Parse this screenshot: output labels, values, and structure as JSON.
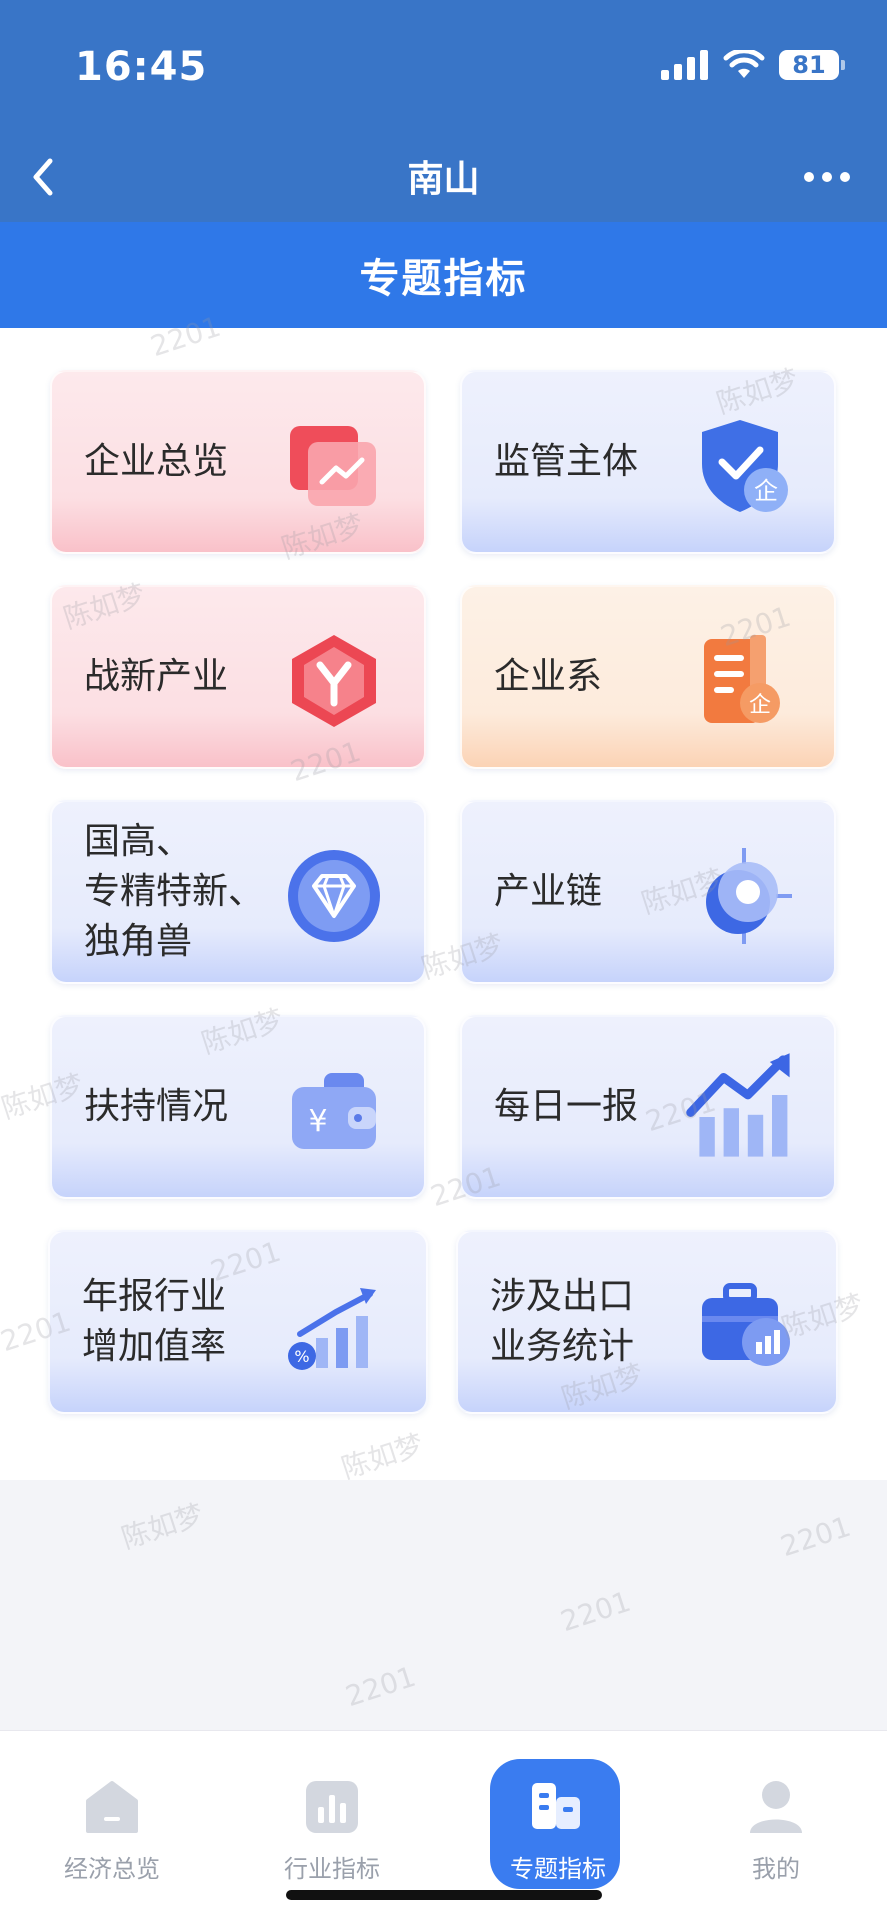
{
  "status_bar": {
    "time": "16:45",
    "battery": "81"
  },
  "nav": {
    "title": "南山",
    "back_icon": "chevron-left-icon",
    "more_icon": "more-dots-icon"
  },
  "section": {
    "title": "专题指标"
  },
  "cards": [
    {
      "lines": [
        "企业总览"
      ],
      "theme": "pink",
      "icon": "enterprise-overview-icon"
    },
    {
      "lines": [
        "监管主体"
      ],
      "theme": "blue",
      "icon": "shield-check-icon"
    },
    {
      "lines": [
        "战新产业"
      ],
      "theme": "pink",
      "icon": "hexagon-y-icon"
    },
    {
      "lines": [
        "企业系"
      ],
      "theme": "orange",
      "icon": "building-document-icon"
    },
    {
      "lines": [
        "国高、",
        "专精特新、",
        "独角兽"
      ],
      "theme": "blue",
      "icon": "diamond-icon"
    },
    {
      "lines": [
        "产业链"
      ],
      "theme": "blue",
      "icon": "target-icon"
    },
    {
      "lines": [
        "扶持情况"
      ],
      "theme": "blue",
      "icon": "wallet-yuan-icon"
    },
    {
      "lines": [
        "每日一报"
      ],
      "theme": "blue",
      "icon": "growth-chart-icon"
    },
    {
      "lines": [
        "年报行业",
        "增加值率"
      ],
      "theme": "blue",
      "icon": "percent-bar-chart-icon"
    },
    {
      "lines": [
        "涉及出口",
        "业务统计"
      ],
      "theme": "blue",
      "icon": "briefcase-chart-icon"
    }
  ],
  "tabs": [
    {
      "label": "经济总览",
      "icon": "home-icon",
      "active": false
    },
    {
      "label": "行业指标",
      "icon": "bar-chart-icon",
      "active": false
    },
    {
      "label": "专题指标",
      "icon": "buildings-icon",
      "active": true
    },
    {
      "label": "我的",
      "icon": "user-icon",
      "active": false
    }
  ],
  "watermarks": [
    "2201",
    "陈如梦"
  ],
  "colors": {
    "primary": "#3975c7",
    "header": "#2f78e8",
    "tab_active": "#3a7cf0"
  }
}
